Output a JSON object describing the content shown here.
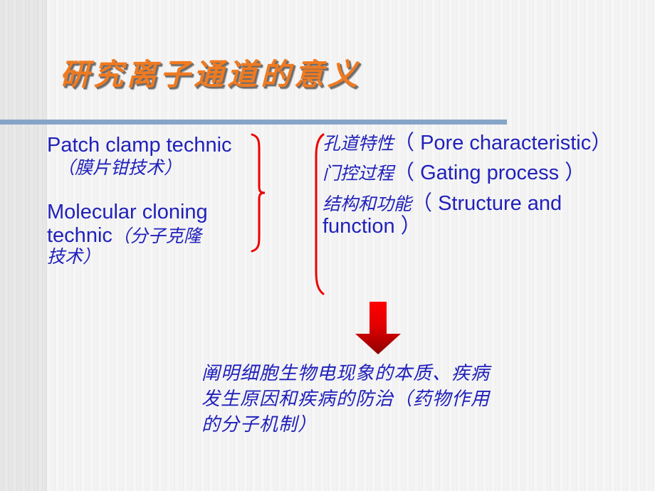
{
  "slide": {
    "title": "研究离子通道的意义",
    "title_color": "#ef7a20",
    "text_color": "#2121bb",
    "accent_color": "#86a4c7",
    "arrow_color": "#d40000"
  },
  "left_column": {
    "items": [
      {
        "latin": "Patch clamp technic",
        "chinese": "（膜片钳技术）"
      },
      {
        "latin_line1": "Molecular cloning",
        "latin_line2": "technic",
        "chinese_line2": "（分子克隆",
        "chinese_line3": "技术）"
      }
    ]
  },
  "right_column": {
    "items": [
      {
        "chinese": "孔道特性",
        "english": "（ Pore characteristic）"
      },
      {
        "chinese": "门控过程",
        "english": "（ Gating process ）"
      },
      {
        "chinese": "结构和功能",
        "english": "（ Structure and function ）"
      }
    ]
  },
  "conclusion": {
    "line1": "阐明细胞生物电现象的本质、疾病",
    "line2": "发生原因和疾病的防治（药物作用",
    "line3": "的分子机制）"
  },
  "icons": {
    "brace": "right-curly-brace",
    "bracket": "left-bracket",
    "arrow": "down-arrow"
  }
}
